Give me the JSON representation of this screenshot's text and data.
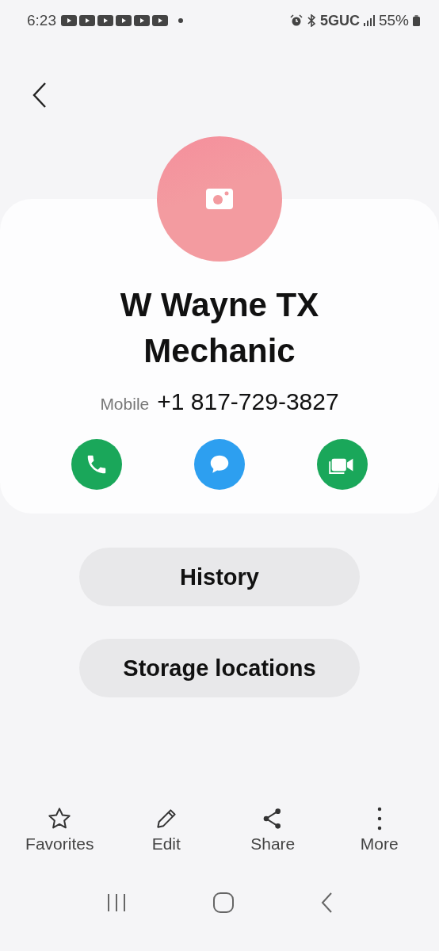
{
  "status_bar": {
    "time": "6:23",
    "network": "5GUC",
    "battery": "55%"
  },
  "contact": {
    "name": "W Wayne TX Mechanic",
    "phone_label": "Mobile",
    "phone": "+1 817-729-3827"
  },
  "quick_actions": [
    {
      "kind": "call",
      "color": "#1aa75a"
    },
    {
      "kind": "message",
      "color": "#2d9ff0"
    },
    {
      "kind": "video",
      "color": "#1aa75a"
    }
  ],
  "buttons": [
    "History",
    "Storage locations"
  ],
  "toolbar": [
    {
      "kind": "favorite",
      "label": "Favorites"
    },
    {
      "kind": "edit",
      "label": "Edit"
    },
    {
      "kind": "share",
      "label": "Share"
    },
    {
      "kind": "more",
      "label": "More"
    }
  ]
}
